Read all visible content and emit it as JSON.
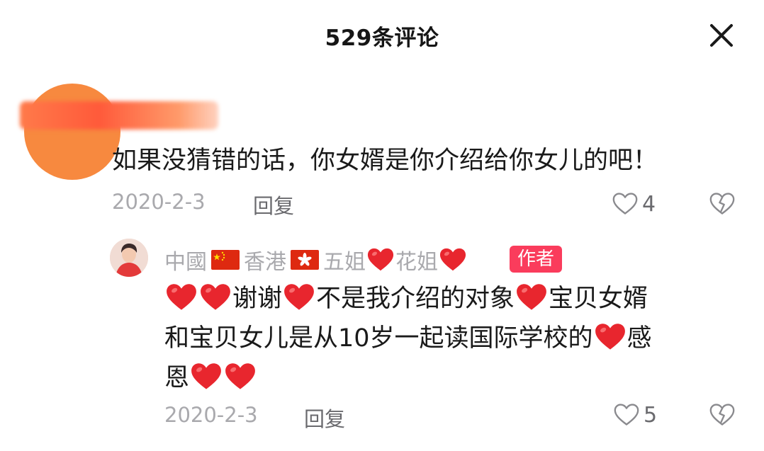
{
  "header": {
    "title": "529条评论",
    "close_icon": "close-icon"
  },
  "comment": {
    "text": "如果没猜错的话，你女婿是你介绍给你女儿的吧！",
    "date": "2020-2-3",
    "reply_label": "回复",
    "like_count": "4"
  },
  "reply": {
    "name_parts": [
      "中國",
      "香港",
      "五姐",
      "花姐"
    ],
    "author_badge": "作者",
    "text_line1": "谢谢",
    "text_seg2": "不是我介绍的对象",
    "text_seg3": "宝贝女婿",
    "text_line2": "和宝贝女儿是从10岁一起读国际学校的",
    "text_seg5": "感",
    "text_line3": "恩",
    "date": "2020-2-3",
    "reply_label": "回复",
    "like_count": "5"
  },
  "colors": {
    "badge": "#fa3c5c",
    "heart": "#e8262e",
    "muted": "#a9a9ad"
  }
}
